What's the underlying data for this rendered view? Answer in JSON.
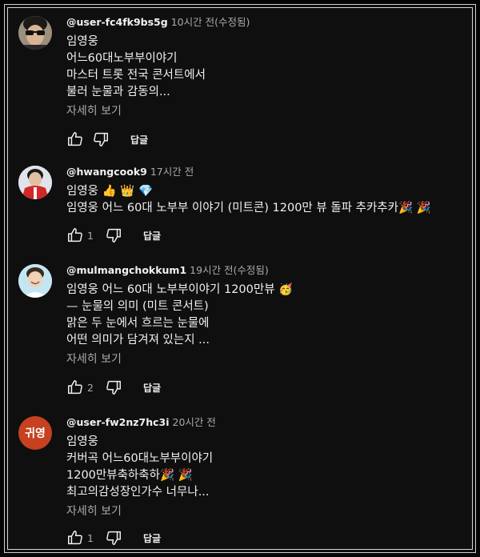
{
  "comments": [
    {
      "handle": "@user-fc4fk9bs5g",
      "time": "10시간 전(수정됨)",
      "lines": [
        "임영웅",
        "어느60대노부부이야기",
        "마스터 트롯 전국 콘서트에서",
        "불러 눈물과 감동의..."
      ],
      "more": "자세히 보기",
      "likes": "",
      "reply": "답글",
      "avatar": "sunglasses-avatar"
    },
    {
      "handle": "@hwangcook9",
      "time": "17시간 전",
      "lines": [
        "임영웅 👍 👑 💎",
        "임영웅 어느 60대 노부부 이야기 (미트콘) 1200만 뷰 돌파 추카추카🎉 🎉"
      ],
      "more": "",
      "likes": "1",
      "reply": "답글",
      "avatar": "red-jacket-avatar"
    },
    {
      "handle": "@mulmangchokkum1",
      "time": "19시간 전(수정됨)",
      "lines": [
        "임영웅 어느 60대 노부부이야기 1200만뷰 🥳",
        "— 눈물의 의미 (미트 콘서트)",
        "맑은 두 눈에서 흐르는 눈물에",
        "어떤 의미가 담겨져 있는지 ..."
      ],
      "more": "자세히 보기",
      "likes": "2",
      "reply": "답글",
      "avatar": "smiling-face-avatar"
    },
    {
      "handle": "@user-fw2nz7hc3i",
      "time": "20시간 전",
      "lines": [
        "임영웅",
        "커버곡 어느60대노부부이야기",
        "1200만뷰축하축하🎉 🎉",
        "최고의감성장인가수 너무나..."
      ],
      "more": "자세히 보기",
      "likes": "1",
      "reply": "답글",
      "avatar": "귀영"
    }
  ],
  "colors": {
    "background": "#0f0f0f",
    "text": "#f1f1f1",
    "secondary": "#aaaaaa",
    "avatar4": "#c6411f"
  }
}
